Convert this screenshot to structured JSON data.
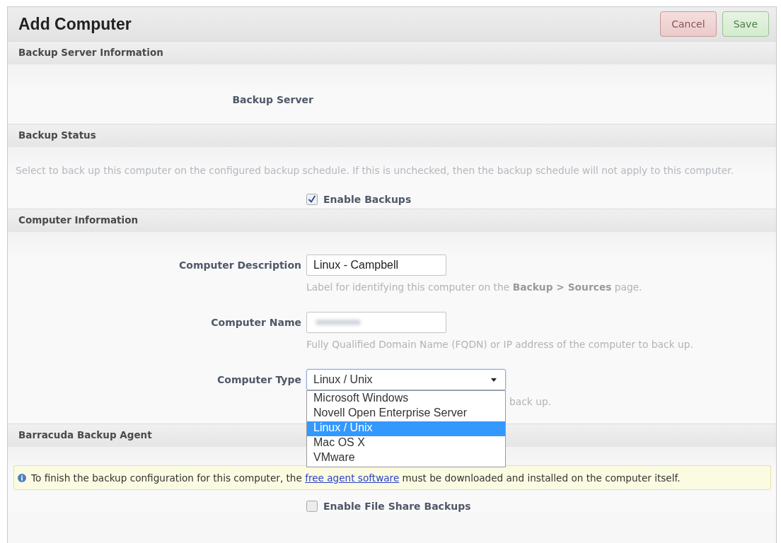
{
  "page": {
    "title": "Add Computer"
  },
  "actions": [
    {
      "label": "Cancel",
      "kind": "cancel"
    },
    {
      "label": "Save",
      "kind": "save"
    }
  ],
  "sections": [
    {
      "title": "Backup Server Information",
      "rows": [
        {
          "kind": "static",
          "label": "Backup Server"
        }
      ]
    },
    {
      "title": "Backup Status",
      "rows": [
        {
          "kind": "note",
          "text": "Select to back up this computer on the configured backup schedule. If this is unchecked, then the backup schedule will not apply to this computer."
        },
        {
          "kind": "checkbox",
          "label": "Enable Backups",
          "checked": true
        }
      ]
    },
    {
      "title": "Computer Information",
      "rows": [
        {
          "kind": "text",
          "label": "Computer Description",
          "value": "Linux - Campbell",
          "help": "Label for identifying this computer on the **Backup > Sources** page."
        },
        {
          "kind": "text",
          "label": "Computer Name",
          "blurred": true,
          "help": "Fully Qualified Domain Name (FQDN) or IP address of the computer to back up."
        },
        {
          "kind": "select",
          "label": "Computer Type",
          "value": "Linux / Unix",
          "expanded": true,
          "options": [
            {
              "label": "Microsoft Windows",
              "selected": false
            },
            {
              "label": "Novell Open Enterprise Server",
              "selected": false
            },
            {
              "label": "Linux / Unix",
              "selected": true
            },
            {
              "label": "Mac OS X",
              "selected": false
            },
            {
              "label": "VMware",
              "selected": false
            }
          ],
          "help": "back up."
        }
      ]
    },
    {
      "title": "Barracuda Backup Agent",
      "rows": [
        {
          "kind": "info",
          "text": "To finish the backup configuration for this computer, the ",
          "link": "free agent software",
          "text_after": " must be downloaded and installed on the computer itself."
        },
        {
          "kind": "checkbox",
          "label": "Enable File Share Backups",
          "checked": false
        }
      ]
    }
  ]
}
